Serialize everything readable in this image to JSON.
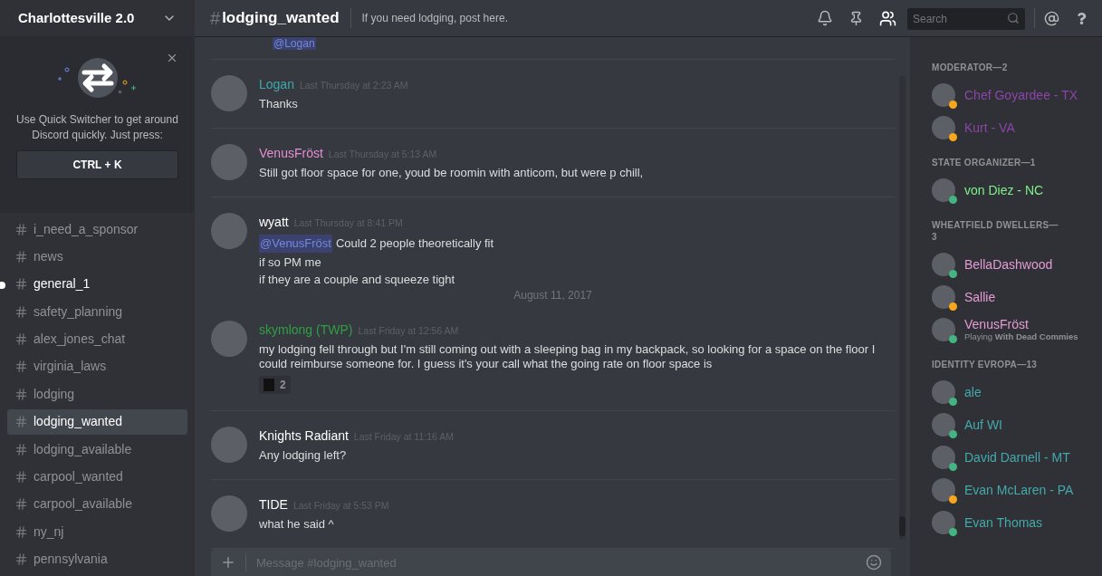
{
  "server": {
    "name": "Charlottesville 2.0"
  },
  "quick_switcher": {
    "text": "Use Quick Switcher to get around Discord quickly. Just press:",
    "shortcut": "CTRL + K"
  },
  "channels": [
    {
      "name": "i_need_a_sponsor",
      "selected": false,
      "unread": false
    },
    {
      "name": "news",
      "selected": false,
      "unread": false
    },
    {
      "name": "general_1",
      "selected": false,
      "unread": true
    },
    {
      "name": "safety_planning",
      "selected": false,
      "unread": false
    },
    {
      "name": "alex_jones_chat",
      "selected": false,
      "unread": false
    },
    {
      "name": "virginia_laws",
      "selected": false,
      "unread": false
    },
    {
      "name": "lodging",
      "selected": false,
      "unread": false
    },
    {
      "name": "lodging_wanted",
      "selected": true,
      "unread": false
    },
    {
      "name": "lodging_available",
      "selected": false,
      "unread": false
    },
    {
      "name": "carpool_wanted",
      "selected": false,
      "unread": false
    },
    {
      "name": "carpool_available",
      "selected": false,
      "unread": false
    },
    {
      "name": "ny_nj",
      "selected": false,
      "unread": false
    },
    {
      "name": "pennsylvania",
      "selected": false,
      "unread": false
    }
  ],
  "header": {
    "hash": "#",
    "channel": "lodging_wanted",
    "topic": "If you need lodging, post here.",
    "search_placeholder": "Search"
  },
  "top_fragment": {
    "mention": "@Logan"
  },
  "messages": [
    {
      "kind": "message",
      "author": "Logan",
      "color": "#3fa9a9",
      "time": "Last Thursday at 2:23 AM",
      "lines": [
        {
          "text": "Thanks"
        }
      ]
    },
    {
      "kind": "message",
      "author": "VenusFröst",
      "color": "#e48fd3",
      "time": "Last Thursday at 5:13 AM",
      "lines": [
        {
          "text": "Still got floor space for one, youd be roomin with anticom, but were p chill,"
        }
      ]
    },
    {
      "kind": "message",
      "author": "wyatt",
      "color": "#ffffff",
      "time": "Last Thursday at 8:41 PM",
      "lines": [
        {
          "mention": "@VenusFröst",
          "text": "Could 2 people theoretically fit"
        },
        {
          "text": "if so PM me"
        },
        {
          "text": "if they are a couple and squeeze tight"
        }
      ]
    },
    {
      "kind": "date_divider",
      "text": "August 11, 2017"
    },
    {
      "kind": "message",
      "author": "skymlong (TWP)",
      "color": "#2ea043",
      "time": "Last Friday at 12:56 AM",
      "lines": [
        {
          "text": "my lodging fell through but I'm still coming out with a sleeping bag in my backpack, so looking for a space on the floor I could reimburse someone for. I guess it's your call what the going rate on floor space is"
        }
      ],
      "reaction": {
        "count": "2"
      }
    },
    {
      "kind": "message",
      "author": "Knights Radiant",
      "color": "#ffffff",
      "time": "Last Friday at 11:16 AM",
      "lines": [
        {
          "text": "Any lodging left?"
        }
      ]
    },
    {
      "kind": "message",
      "author": "TIDE",
      "color": "#ffffff",
      "time": "Last Friday at 5:53 PM",
      "lines": [
        {
          "text": "what he said ^"
        }
      ]
    }
  ],
  "composer": {
    "placeholder": "Message #lodging_wanted"
  },
  "member_groups": [
    {
      "title": "MODERATOR—2",
      "members": [
        {
          "name": "Chef Goyardee - TX",
          "color": "#8b45a9",
          "status": {
            "color": "#faa61a"
          }
        },
        {
          "name": "Kurt - VA",
          "color": "#8b45a9",
          "status": {
            "color": "#faa61a"
          }
        }
      ]
    },
    {
      "title": "STATE ORGANIZER—1",
      "members": [
        {
          "name": "von Diez - NC",
          "color": "#7ff08c",
          "status": {
            "color": "#43b581"
          }
        }
      ]
    },
    {
      "title": "WHEATFIELD DWELLERS—3",
      "members": [
        {
          "name": "BellaDashwood",
          "color": "#e69bd6",
          "status": {
            "color": "#43b581"
          }
        },
        {
          "name": "Sallie",
          "color": "#e69bd6",
          "status": {
            "color": "#faa61a"
          }
        },
        {
          "name": "VenusFröst",
          "color": "#e69bd6",
          "status": {
            "color": "#43b581"
          },
          "activity_prefix": "Playing",
          "activity": "With Dead Commies"
        }
      ]
    },
    {
      "title": "IDENTITY EVROPA—13",
      "members": [
        {
          "name": "ale",
          "color": "#45a9ab",
          "status": {
            "color": "#43b581"
          }
        },
        {
          "name": "Auf WI",
          "color": "#45a9ab",
          "status": {
            "color": "#43b581"
          }
        },
        {
          "name": "David Darnell - MT",
          "color": "#45a9ab",
          "status": {
            "color": "#43b581"
          }
        },
        {
          "name": "Evan McLaren - PA",
          "color": "#45a9ab",
          "status": {
            "color": "#faa61a"
          }
        },
        {
          "name": "Evan Thomas",
          "color": "#45a9ab",
          "status": {
            "color": "#43b581"
          }
        }
      ]
    }
  ]
}
